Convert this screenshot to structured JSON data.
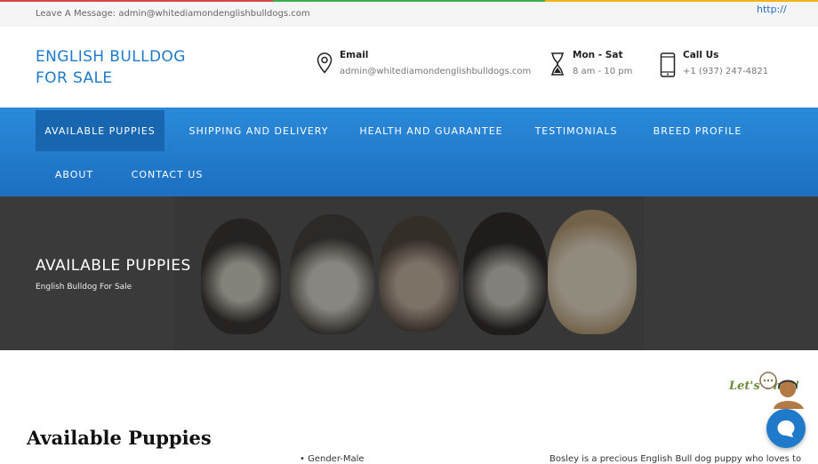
{
  "colors": {
    "brand": "#1f7ac9",
    "nav_bg": "#2a8ad9",
    "rainbow": [
      "#d64545",
      "#3cae4a",
      "#f2b21b"
    ]
  },
  "topbar": {
    "message": "Leave A Message: admin@whitediamondenglishbulldogs.com",
    "link": "http://"
  },
  "header": {
    "logo_line1": "ENGLISH BULLDOG",
    "logo_line2": "FOR SALE",
    "email": {
      "icon": "location-pin-icon",
      "title": "Email",
      "value": "admin@whitediamondenglishbulldogs.com"
    },
    "hours": {
      "icon": "hourglass-icon",
      "title": "Mon - Sat",
      "value": "8 am - 10 pm"
    },
    "phone": {
      "icon": "phone-icon",
      "title": "Call Us",
      "value": "+1 (937) 247-4821"
    }
  },
  "nav": {
    "items": [
      {
        "label": "AVAILABLE PUPPIES",
        "active": true
      },
      {
        "label": "SHIPPING AND DELIVERY"
      },
      {
        "label": "HEALTH AND GUARANTEE"
      },
      {
        "label": "TESTIMONIALS"
      },
      {
        "label": "BREED PROFILE"
      },
      {
        "label": "ABOUT"
      },
      {
        "label": "CONTACT US"
      }
    ]
  },
  "hero": {
    "title": "AVAILABLE PUPPIES",
    "subtitle": "English Bulldog For Sale"
  },
  "main": {
    "title": "Available Puppies",
    "list_first": "• Gender-Male",
    "desc_first": "Bosley is a precious English Bull dog puppy who loves to"
  },
  "chat": {
    "badge_text": "Let's Chat!",
    "icon": "chat-bubble-icon"
  }
}
